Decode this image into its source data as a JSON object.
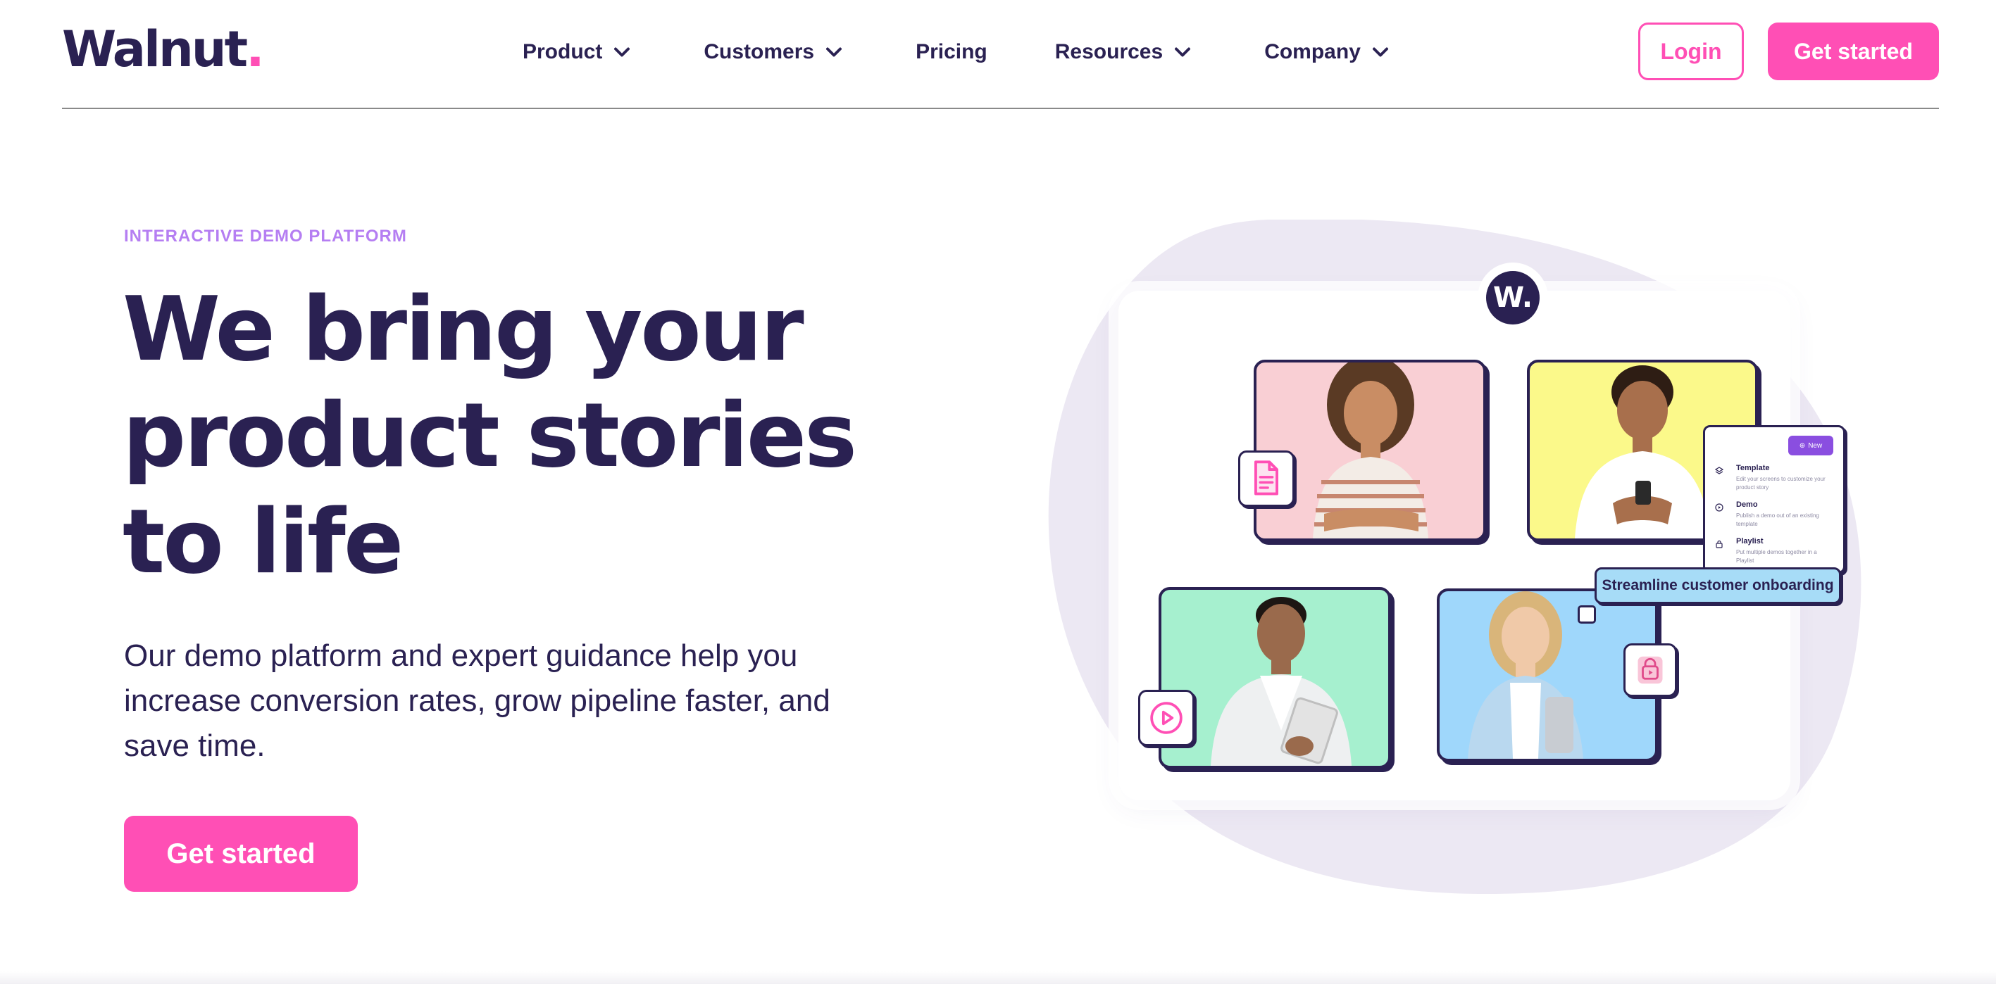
{
  "header": {
    "logo_text": "Walnut",
    "logo_dot": ".",
    "nav": [
      {
        "label": "Product",
        "has_dropdown": true
      },
      {
        "label": "Customers",
        "has_dropdown": true
      },
      {
        "label": "Pricing",
        "has_dropdown": false
      },
      {
        "label": "Resources",
        "has_dropdown": true
      },
      {
        "label": "Company",
        "has_dropdown": true
      }
    ],
    "login_label": "Login",
    "get_started_label": "Get started"
  },
  "hero": {
    "eyebrow": "INTERACTIVE DEMO PLATFORM",
    "headline_lines": [
      "We bring your",
      "product stories",
      "to life"
    ],
    "subheading_lines": [
      "Our demo platform and expert guidance help you",
      "increase conversion rates, grow pipeline faster, and",
      "save time."
    ],
    "cta_label": "Get started"
  },
  "illustration": {
    "badge_letter": "W.",
    "tooltip": "Streamline customer onboarding",
    "menu": {
      "new_label": "New",
      "items": [
        {
          "title": "Template",
          "description": "Edit your screens to customize your product story",
          "icon": "layers-icon"
        },
        {
          "title": "Demo",
          "description": "Publish a demo out of an existing template",
          "icon": "play-circle-icon"
        },
        {
          "title": "Playlist",
          "description": "Put multiple demos together in a Playlist",
          "icon": "lock-icon"
        }
      ]
    },
    "chips": [
      "document-icon",
      "play-icon",
      "lock-play-icon"
    ]
  },
  "colors": {
    "brand_navy": "#2a2152",
    "brand_pink": "#ff4fb5",
    "eyebrow_purple": "#b57ef2",
    "blob_lavender": "#ece8f3",
    "photo_pink": "#f9cfd4",
    "photo_yellow": "#fbf98a",
    "photo_mint": "#a6f0cf",
    "photo_blue": "#9fd7fb"
  }
}
